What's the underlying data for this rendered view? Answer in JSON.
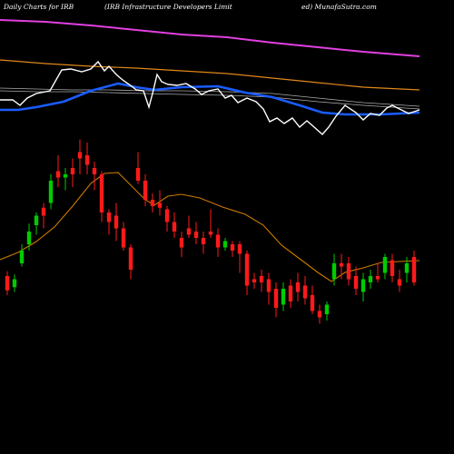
{
  "header": {
    "left": "Daily Charts for IRB",
    "middle": "(IRB Infrastructure   Developers Limit",
    "right": "ed) MunafaSutra.com"
  },
  "chart_data": {
    "type": "candlestick",
    "colors": {
      "up": "#00cc00",
      "down": "#ff1a1a",
      "ma_short": "#cc7a00",
      "ma_orange": "#e0871a",
      "ma_magenta": "#e040e0",
      "ma_blue": "#1a5cff",
      "ma_white": "#ffffff",
      "ma_grey": "#aaaaaa"
    },
    "price_range": [
      0,
      100
    ],
    "candles": [
      {
        "o": 32,
        "c": 23,
        "h": 35,
        "l": 20,
        "d": "down"
      },
      {
        "o": 25,
        "c": 30,
        "h": 33,
        "l": 22,
        "d": "up"
      },
      {
        "o": 40,
        "c": 48,
        "h": 52,
        "l": 38,
        "d": "up"
      },
      {
        "o": 52,
        "c": 60,
        "h": 65,
        "l": 48,
        "d": "up"
      },
      {
        "o": 64,
        "c": 70,
        "h": 72,
        "l": 58,
        "d": "up"
      },
      {
        "o": 75,
        "c": 70,
        "h": 78,
        "l": 62,
        "d": "down"
      },
      {
        "o": 78,
        "c": 92,
        "h": 96,
        "l": 74,
        "d": "up"
      },
      {
        "o": 98,
        "c": 94,
        "h": 108,
        "l": 88,
        "d": "down"
      },
      {
        "o": 94,
        "c": 96,
        "h": 100,
        "l": 86,
        "d": "up"
      },
      {
        "o": 100,
        "c": 96,
        "h": 106,
        "l": 88,
        "d": "down"
      },
      {
        "o": 110,
        "c": 106,
        "h": 118,
        "l": 96,
        "d": "down"
      },
      {
        "o": 108,
        "c": 102,
        "h": 116,
        "l": 96,
        "d": "down"
      },
      {
        "o": 100,
        "c": 96,
        "h": 104,
        "l": 86,
        "d": "down"
      },
      {
        "o": 96,
        "c": 72,
        "h": 98,
        "l": 66,
        "d": "down"
      },
      {
        "o": 72,
        "c": 66,
        "h": 74,
        "l": 58,
        "d": "down"
      },
      {
        "o": 70,
        "c": 62,
        "h": 78,
        "l": 54,
        "d": "down"
      },
      {
        "o": 62,
        "c": 50,
        "h": 66,
        "l": 48,
        "d": "down"
      },
      {
        "o": 50,
        "c": 36,
        "h": 52,
        "l": 30,
        "d": "down"
      },
      {
        "o": 100,
        "c": 92,
        "h": 110,
        "l": 90,
        "d": "down"
      },
      {
        "o": 92,
        "c": 80,
        "h": 96,
        "l": 76,
        "d": "down"
      },
      {
        "o": 80,
        "c": 76,
        "h": 84,
        "l": 72,
        "d": "down"
      },
      {
        "o": 78,
        "c": 75,
        "h": 86,
        "l": 70,
        "d": "down"
      },
      {
        "o": 74,
        "c": 66,
        "h": 76,
        "l": 60,
        "d": "down"
      },
      {
        "o": 66,
        "c": 60,
        "h": 72,
        "l": 56,
        "d": "down"
      },
      {
        "o": 56,
        "c": 50,
        "h": 60,
        "l": 44,
        "d": "down"
      },
      {
        "o": 62,
        "c": 58,
        "h": 70,
        "l": 56,
        "d": "down"
      },
      {
        "o": 60,
        "c": 56,
        "h": 66,
        "l": 52,
        "d": "down"
      },
      {
        "o": 56,
        "c": 52,
        "h": 60,
        "l": 46,
        "d": "down"
      },
      {
        "o": 60,
        "c": 58,
        "h": 74,
        "l": 56,
        "d": "down"
      },
      {
        "o": 58,
        "c": 50,
        "h": 62,
        "l": 44,
        "d": "down"
      },
      {
        "o": 50,
        "c": 54,
        "h": 56,
        "l": 48,
        "d": "up"
      },
      {
        "o": 52,
        "c": 48,
        "h": 54,
        "l": 44,
        "d": "down"
      },
      {
        "o": 52,
        "c": 46,
        "h": 54,
        "l": 34,
        "d": "down"
      },
      {
        "o": 46,
        "c": 26,
        "h": 48,
        "l": 20,
        "d": "down"
      },
      {
        "o": 30,
        "c": 28,
        "h": 34,
        "l": 24,
        "d": "down"
      },
      {
        "o": 32,
        "c": 28,
        "h": 36,
        "l": 22,
        "d": "down"
      },
      {
        "o": 30,
        "c": 22,
        "h": 34,
        "l": 14,
        "d": "down"
      },
      {
        "o": 24,
        "c": 12,
        "h": 28,
        "l": 6,
        "d": "down"
      },
      {
        "o": 14,
        "c": 24,
        "h": 28,
        "l": 10,
        "d": "up"
      },
      {
        "o": 26,
        "c": 16,
        "h": 30,
        "l": 12,
        "d": "down"
      },
      {
        "o": 28,
        "c": 22,
        "h": 34,
        "l": 16,
        "d": "down"
      },
      {
        "o": 26,
        "c": 18,
        "h": 32,
        "l": 14,
        "d": "down"
      },
      {
        "o": 20,
        "c": 10,
        "h": 26,
        "l": 8,
        "d": "down"
      },
      {
        "o": 10,
        "c": 6,
        "h": 14,
        "l": 2,
        "d": "down"
      },
      {
        "o": 8,
        "c": 14,
        "h": 16,
        "l": 4,
        "d": "up"
      },
      {
        "o": 30,
        "c": 40,
        "h": 46,
        "l": 26,
        "d": "up"
      },
      {
        "o": 40,
        "c": 38,
        "h": 46,
        "l": 30,
        "d": "down"
      },
      {
        "o": 40,
        "c": 30,
        "h": 44,
        "l": 26,
        "d": "down"
      },
      {
        "o": 32,
        "c": 24,
        "h": 38,
        "l": 20,
        "d": "down"
      },
      {
        "o": 22,
        "c": 30,
        "h": 34,
        "l": 16,
        "d": "up"
      },
      {
        "o": 28,
        "c": 32,
        "h": 36,
        "l": 24,
        "d": "up"
      },
      {
        "o": 32,
        "c": 30,
        "h": 40,
        "l": 28,
        "d": "down"
      },
      {
        "o": 34,
        "c": 44,
        "h": 46,
        "l": 30,
        "d": "up"
      },
      {
        "o": 42,
        "c": 32,
        "h": 46,
        "l": 28,
        "d": "down"
      },
      {
        "o": 30,
        "c": 26,
        "h": 36,
        "l": 22,
        "d": "down"
      },
      {
        "o": 34,
        "c": 40,
        "h": 44,
        "l": 28,
        "d": "up"
      },
      {
        "o": 44,
        "c": 28,
        "h": 48,
        "l": 26,
        "d": "down"
      }
    ]
  }
}
